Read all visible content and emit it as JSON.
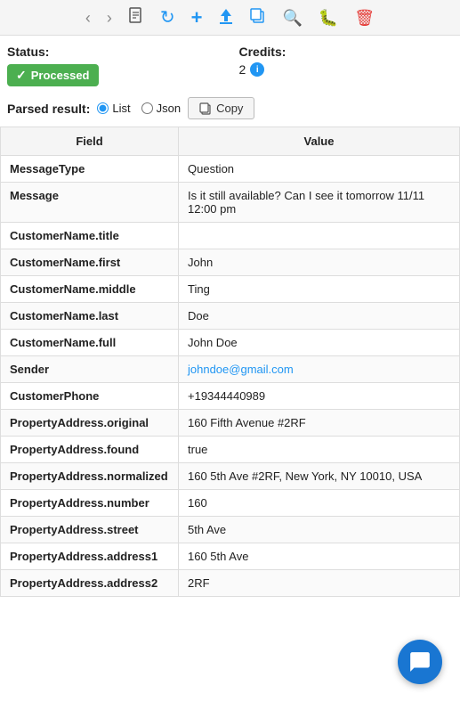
{
  "toolbar": {
    "back_label": "‹",
    "forward_label": "›",
    "document_label": "📄",
    "refresh_label": "↻",
    "add_label": "+",
    "upload_label": "▲",
    "copy_label": "⧉",
    "search_label": "🔍",
    "bug_label": "🐛",
    "delete_label": "🗑"
  },
  "status": {
    "label": "Status:",
    "badge_text": "Processed",
    "credits_label": "Credits:",
    "credits_value": "2"
  },
  "parsed_result": {
    "label": "Parsed result:",
    "radio_list": "List",
    "radio_json": "Json",
    "copy_button": "Copy"
  },
  "table": {
    "col_field": "Field",
    "col_value": "Value",
    "rows": [
      {
        "field": "MessageType",
        "value": "Question",
        "is_email": false
      },
      {
        "field": "Message",
        "value": "Is it still available? Can I see it tomorrow 11/11 12:00 pm",
        "is_email": false
      },
      {
        "field": "CustomerName.title",
        "value": "",
        "is_email": false
      },
      {
        "field": "CustomerName.first",
        "value": "John",
        "is_email": false
      },
      {
        "field": "CustomerName.middle",
        "value": "Ting",
        "is_email": false
      },
      {
        "field": "CustomerName.last",
        "value": "Doe",
        "is_email": false
      },
      {
        "field": "CustomerName.full",
        "value": "John Doe",
        "is_email": false
      },
      {
        "field": "Sender",
        "value": "johndoe@gmail.com",
        "is_email": true
      },
      {
        "field": "CustomerPhone",
        "value": "+19344440989",
        "is_email": false
      },
      {
        "field": "PropertyAddress.original",
        "value": "160 Fifth Avenue #2RF",
        "is_email": false
      },
      {
        "field": "PropertyAddress.found",
        "value": "true",
        "is_email": false
      },
      {
        "field": "PropertyAddress.normalized",
        "value": "160 5th Ave #2RF, New York, NY 10010, USA",
        "is_email": false
      },
      {
        "field": "PropertyAddress.number",
        "value": "160",
        "is_email": false
      },
      {
        "field": "PropertyAddress.street",
        "value": "5th Ave",
        "is_email": false
      },
      {
        "field": "PropertyAddress.address1",
        "value": "160 5th Ave",
        "is_email": false
      },
      {
        "field": "PropertyAddress.address2",
        "value": "2RF",
        "is_email": false
      }
    ]
  }
}
